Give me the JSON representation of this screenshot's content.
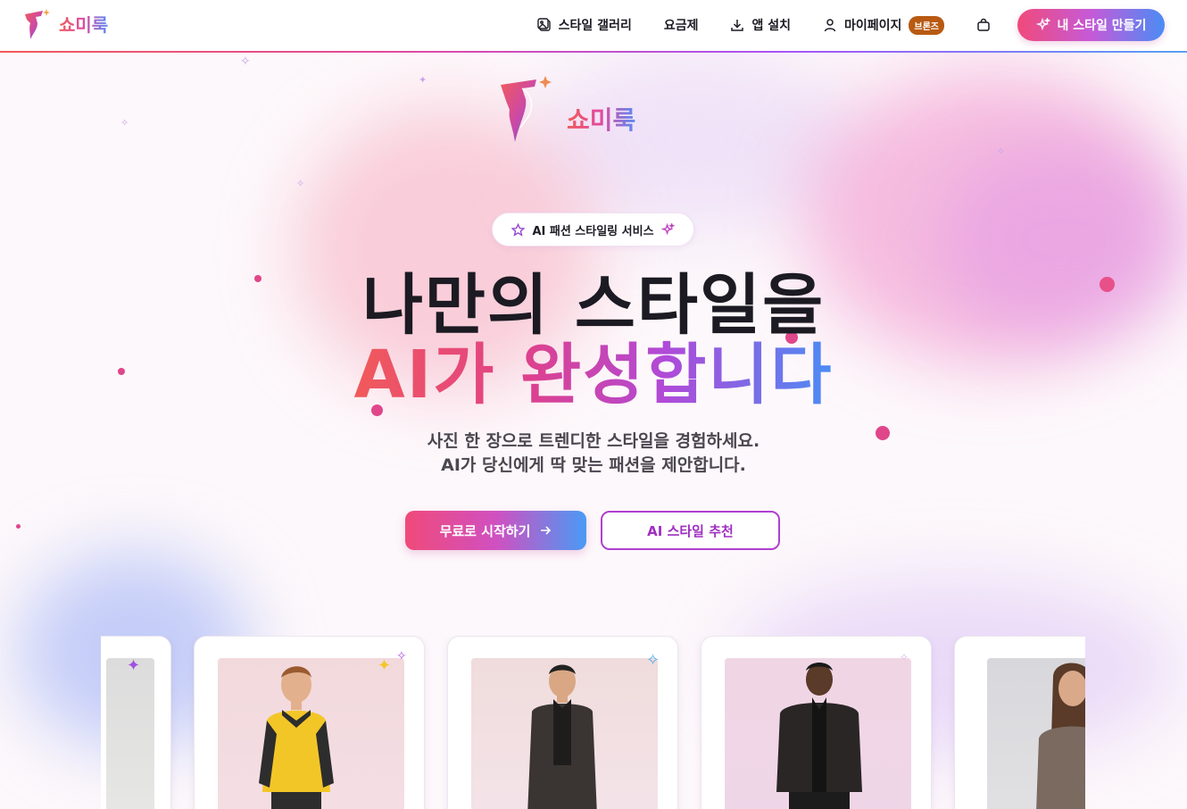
{
  "brand": {
    "name": "쇼미룩"
  },
  "nav": {
    "gallery": "스타일 갤러리",
    "pricing": "요금제",
    "install": "앱 설치",
    "mypage": "마이페이지",
    "tier_badge": "브론즈",
    "cta": "내 스타일 만들기"
  },
  "hero": {
    "pill": "AI 패션 스타일링 서비스",
    "headline_line1": "나만의 스타일을",
    "headline_line2": "AI가 완성합니다",
    "sub_line1": "사진 한 장으로 트렌디한 스타일을 경험하세요.",
    "sub_line2": "AI가 당신에게 딱 맞는 패션을 제안합니다.",
    "primary_button": "무료로 시작하기",
    "secondary_button": "AI 스타일 추천"
  },
  "colors": {
    "accent_pink": "#f04a7a",
    "accent_purple": "#b040d0",
    "accent_blue": "#4a8cf5",
    "badge_bronze": "#b85a12"
  },
  "icons": [
    "logo-icon",
    "gallery-icon",
    "download-icon",
    "user-icon",
    "cart-icon",
    "sparkle-icon",
    "star-icon",
    "arrow-right-icon"
  ]
}
